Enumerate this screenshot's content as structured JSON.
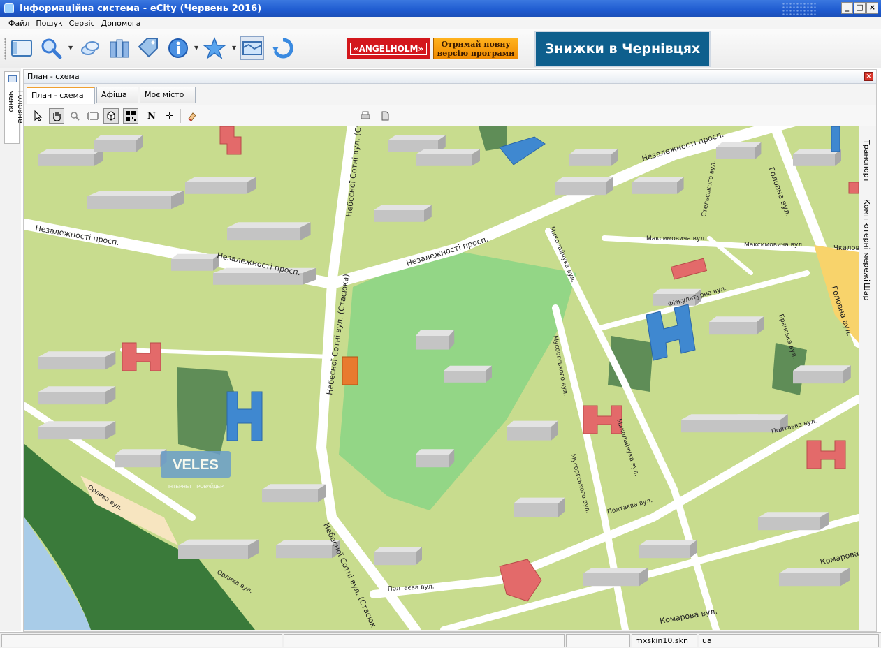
{
  "window": {
    "title": "Інформаційна система - eCity (Червень 2016)"
  },
  "menu": [
    "Файл",
    "Пошук",
    "Сервіс",
    "Допомога"
  ],
  "ads": {
    "angelholm": "«ANGELHOLM»",
    "full_version": [
      "Отримай повну",
      "версію програми"
    ],
    "discounts": "Знижки в Чернівцях"
  },
  "sidebar_left": {
    "tab_label": "Головне меню"
  },
  "panel": {
    "title": "План - схема",
    "tabs": [
      {
        "label": "План - схема",
        "active": true
      },
      {
        "label": "Афіша",
        "active": false
      },
      {
        "label": "Моє місто",
        "active": false
      }
    ]
  },
  "sidebar_right": {
    "tabs": [
      "Транспорт",
      "Комп'ютерні мережі",
      "Шар"
    ]
  },
  "map": {
    "watermark": {
      "brand": "VELES",
      "subtitle": "ІНТЕРНЕТ ПРОВАЙДЕР"
    },
    "streets": {
      "nezalezhnosti_1": "Незалежності просп.",
      "nezalezhnosti_2": "Незалежності просп.",
      "nezalezhnosti_3": "Незалежності просп.",
      "nezalezhnosti_4": "Незалежності просп.",
      "nebesnoi_1": "Небесної Сотні вул. (Ст",
      "nebesnoi_2": "Небесної Сотні вул. (Стасюка)",
      "nebesnoi_3": "Небесної Сотні вул. (Стасюк",
      "holovna_1": "Головна вул.",
      "holovna_2": "Головна вул.",
      "maksymovycha_1": "Максимовича вул.",
      "maksymovycha_2": "Максимовича вул.",
      "chkalova": "Чкалова",
      "fizkultury": "Фізкультурна вул.",
      "brianska": "Брянська вул.",
      "stepovskoho": "Стельського вул.",
      "mykolaichuka_1": "Миколайчука вул.",
      "mykolaichuka_2": "Миколайчука вул.",
      "musorhskoho_1": "Мусоргського вул.",
      "musorhskoho_2": "Мусоргського вул.",
      "poltaieva_1": "Полтаєва вул.",
      "poltaieva_2": "Полтаєва вул.",
      "poltaieva_3": "Полтаєва вул.",
      "komarova_1": "Комарова",
      "komarova_2": "Комарова вул.",
      "orlyka_1": "Орлика вул.",
      "orlyka_2": "Орлика вул."
    }
  },
  "statusbar": {
    "skin": "mxskin10.skn",
    "lang": "ua"
  },
  "colors": {
    "grass": "#c8dc8e",
    "park": "#93d686",
    "road": "#ffffff",
    "building": "#c9c9c9",
    "school": "#e36a6a",
    "kindergarten": "#3f88d0",
    "titlebar": "#1f5bd0"
  }
}
